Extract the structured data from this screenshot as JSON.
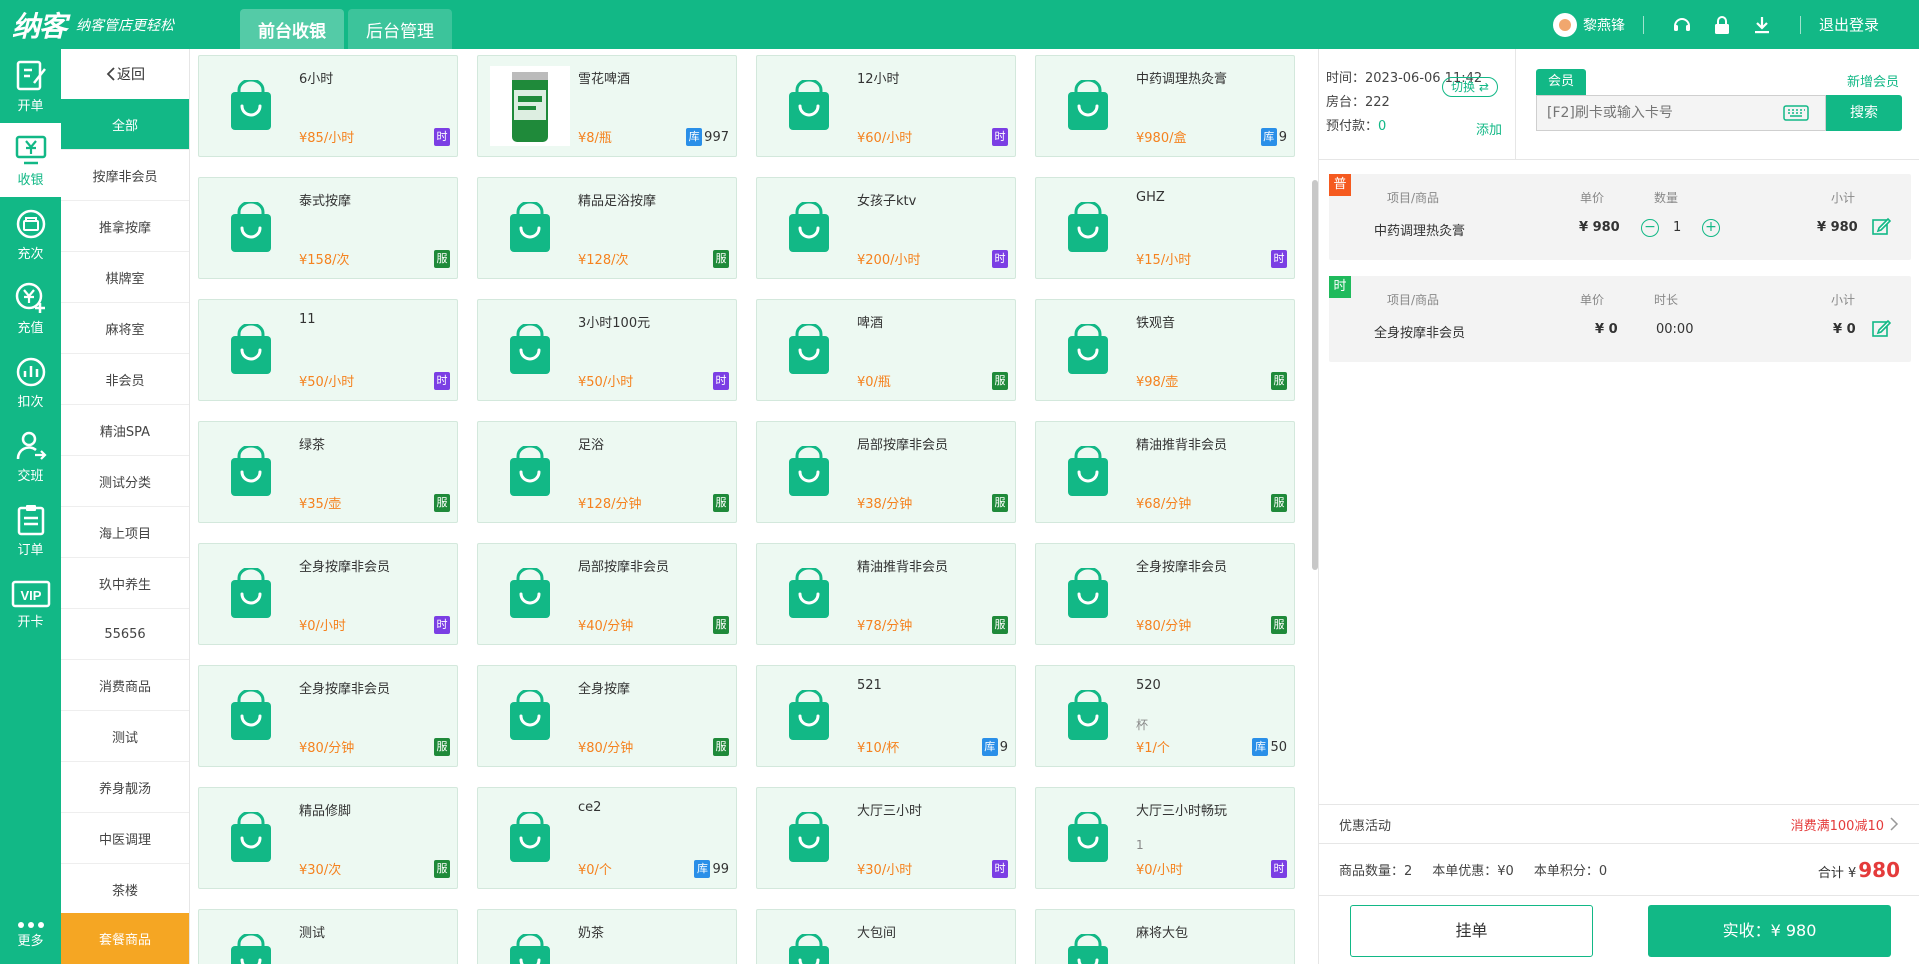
{
  "header": {
    "logo": "纳客",
    "slogan": "纳客管店更轻松",
    "tabs": [
      {
        "label": "前台收银",
        "active": true
      },
      {
        "label": "后台管理",
        "active": false
      }
    ],
    "user_name": "黎燕锋",
    "logout_label": "退出登录",
    "icons": [
      "headset-icon",
      "lock-icon",
      "download-icon"
    ],
    "accent": "#12b886"
  },
  "nav": {
    "items": [
      {
        "label": "开单",
        "icon": "order-open-icon"
      },
      {
        "label": "收银",
        "icon": "cashier-icon"
      },
      {
        "label": "充次",
        "icon": "recharge-times-icon"
      },
      {
        "label": "充值",
        "icon": "recharge-money-icon"
      },
      {
        "label": "扣次",
        "icon": "deduct-times-icon"
      },
      {
        "label": "交班",
        "icon": "shift-handover-icon"
      },
      {
        "label": "订单",
        "icon": "orders-icon"
      },
      {
        "label": "开卡",
        "icon": "vip-card-icon"
      }
    ],
    "more_label": "更多"
  },
  "categories": {
    "back_label": "返回",
    "items": [
      "全部",
      "按摩非会员",
      "推拿按摩",
      "棋牌室",
      "麻将室",
      "非会员",
      "精油SPA",
      "测试分类",
      "海上项目",
      "玖中养生",
      "55656",
      "消费商品",
      "测试",
      "养身靓汤",
      "中医调理",
      "茶楼"
    ],
    "combo_label": "套餐商品"
  },
  "products": [
    {
      "name": "6小时",
      "price": "¥85/小时",
      "tag": "时",
      "tag_type": "time",
      "stock": ""
    },
    {
      "name": "雪花啤酒",
      "price": "¥8/瓶",
      "tag": "库",
      "tag_type": "stock",
      "stock": "997",
      "image": "beer-can"
    },
    {
      "name": "12小时",
      "price": "¥60/小时",
      "tag": "时",
      "tag_type": "time",
      "stock": ""
    },
    {
      "name": "中药调理热灸膏",
      "price": "¥980/盒",
      "tag": "库",
      "tag_type": "stock",
      "stock": "9"
    },
    {
      "name": "泰式按摩",
      "price": "¥158/次",
      "tag": "服",
      "tag_type": "serv",
      "stock": ""
    },
    {
      "name": "精品足浴按摩",
      "price": "¥128/次",
      "tag": "服",
      "tag_type": "serv",
      "stock": ""
    },
    {
      "name": "女孩子ktv",
      "price": "¥200/小时",
      "tag": "时",
      "tag_type": "time",
      "stock": ""
    },
    {
      "name": "GHZ",
      "price": "¥15/小时",
      "tag": "时",
      "tag_type": "time",
      "stock": ""
    },
    {
      "name": "11",
      "price": "¥50/小时",
      "tag": "时",
      "tag_type": "time",
      "stock": ""
    },
    {
      "name": "3小时100元",
      "price": "¥50/小时",
      "tag": "时",
      "tag_type": "time",
      "stock": ""
    },
    {
      "name": "啤酒",
      "price": "¥0/瓶",
      "tag": "服",
      "tag_type": "serv",
      "stock": ""
    },
    {
      "name": "铁观音",
      "price": "¥98/壶",
      "tag": "服",
      "tag_type": "serv",
      "stock": ""
    },
    {
      "name": "绿茶",
      "price": "¥35/壶",
      "tag": "服",
      "tag_type": "serv",
      "stock": ""
    },
    {
      "name": "足浴",
      "price": "¥128/分钟",
      "tag": "服",
      "tag_type": "serv",
      "stock": ""
    },
    {
      "name": "局部按摩非会员",
      "price": "¥38/分钟",
      "tag": "服",
      "tag_type": "serv",
      "stock": ""
    },
    {
      "name": "精油推背非会员",
      "price": "¥68/分钟",
      "tag": "服",
      "tag_type": "serv",
      "stock": ""
    },
    {
      "name": "全身按摩非会员",
      "price": "¥0/小时",
      "tag": "时",
      "tag_type": "time",
      "stock": ""
    },
    {
      "name": "局部按摩非会员",
      "price": "¥40/分钟",
      "tag": "服",
      "tag_type": "serv",
      "stock": ""
    },
    {
      "name": "精油推背非会员",
      "price": "¥78/分钟",
      "tag": "服",
      "tag_type": "serv",
      "stock": ""
    },
    {
      "name": "全身按摩非会员",
      "price": "¥80/分钟",
      "tag": "服",
      "tag_type": "serv",
      "stock": ""
    },
    {
      "name": "全身按摩非会员",
      "price": "¥80/分钟",
      "tag": "服",
      "tag_type": "serv",
      "stock": ""
    },
    {
      "name": "全身按摩",
      "price": "¥80/分钟",
      "tag": "服",
      "tag_type": "serv",
      "stock": ""
    },
    {
      "name": "521",
      "price": "¥10/杯",
      "tag": "库",
      "tag_type": "stock",
      "stock": "9"
    },
    {
      "name": "520",
      "extra": "杯",
      "price": "¥1/个",
      "tag": "库",
      "tag_type": "stock",
      "stock": "50"
    },
    {
      "name": "精品修脚",
      "price": "¥30/次",
      "tag": "服",
      "tag_type": "serv",
      "stock": ""
    },
    {
      "name": "ce2",
      "price": "¥0/个",
      "tag": "库",
      "tag_type": "stock",
      "stock": "99"
    },
    {
      "name": "大厅三小时",
      "price": "¥30/小时",
      "tag": "时",
      "tag_type": "time",
      "stock": ""
    },
    {
      "name": "大厅三小时畅玩",
      "extra": "1",
      "price": "¥0/小时",
      "tag": "时",
      "tag_type": "time",
      "stock": ""
    },
    {
      "name": "测试",
      "price": "",
      "tag": "",
      "tag_type": "",
      "stock": ""
    },
    {
      "name": "奶茶",
      "price": "",
      "tag": "",
      "tag_type": "",
      "stock": ""
    },
    {
      "name": "大包间",
      "price": "",
      "tag": "",
      "tag_type": "",
      "stock": ""
    },
    {
      "name": "麻将大包",
      "price": "",
      "tag": "",
      "tag_type": "",
      "stock": ""
    }
  ],
  "info": {
    "time": "时间：2023-06-06 11:42",
    "room": "房台：222",
    "switch_label": "切换 ⇄",
    "prepay_label": "预付款：",
    "prepay_value": "0",
    "add_label": "添加"
  },
  "member": {
    "tab_label": "会员",
    "new_label": "新增会员",
    "search_placeholder": "[F2]刷卡或输入卡号",
    "search_label": "搜索"
  },
  "goods_order": {
    "badge": "普",
    "col_item": "项目/商品",
    "col_price": "单价",
    "col_qty": "数量",
    "col_subtotal": "小计",
    "item": "中药调理热灸膏",
    "price": "¥ 980",
    "qty": "1",
    "subtotal": "¥ 980"
  },
  "time_order": {
    "badge": "时",
    "col_item": "项目/商品",
    "col_price": "单价",
    "col_duration": "时长",
    "col_subtotal": "小计",
    "item": "全身按摩非会员",
    "price": "¥ 0",
    "duration": "00:00",
    "subtotal": "¥ 0"
  },
  "promo": {
    "label": "优惠活动",
    "value": "消费满100减10"
  },
  "summary": {
    "count": "商品数量：2",
    "discount": "本单优惠：¥0",
    "points": "本单积分：0",
    "total_label": "合计 ¥",
    "total_value": "980"
  },
  "actions": {
    "hold_label": "挂单",
    "pay_label": "实收：¥ 980"
  }
}
